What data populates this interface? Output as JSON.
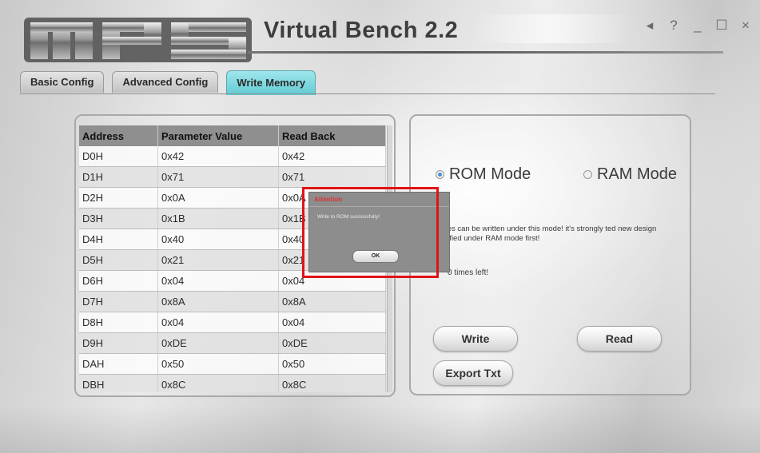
{
  "app": {
    "title": "Virtual Bench 2.2",
    "logo_text": "MPS"
  },
  "window_controls": {
    "sound": "◂",
    "help": "?",
    "minimize": "_",
    "maximize": "☐",
    "close": "×"
  },
  "tabs": [
    {
      "label": "Basic Config",
      "active": false
    },
    {
      "label": "Advanced Config",
      "active": false
    },
    {
      "label": "Write Memory",
      "active": true
    }
  ],
  "table": {
    "headers": [
      "Address",
      "Parameter Value",
      "Read Back"
    ],
    "rows": [
      [
        "D0H",
        "0x42",
        "0x42"
      ],
      [
        "D1H",
        "0x71",
        "0x71"
      ],
      [
        "D2H",
        "0x0A",
        "0x0A"
      ],
      [
        "D3H",
        "0x1B",
        "0x1B"
      ],
      [
        "D4H",
        "0x40",
        "0x40"
      ],
      [
        "D5H",
        "0x21",
        "0x21"
      ],
      [
        "D6H",
        "0x04",
        "0x04"
      ],
      [
        "D7H",
        "0x8A",
        "0x8A"
      ],
      [
        "D8H",
        "0x04",
        "0x04"
      ],
      [
        "D9H",
        "0xDE",
        "0xDE"
      ],
      [
        "DAH",
        "0x50",
        "0x50"
      ],
      [
        "DBH",
        "0x8C",
        "0x8C"
      ]
    ]
  },
  "modes": {
    "rom": {
      "label": "ROM Mode",
      "selected": true
    },
    "ram": {
      "label": "RAM Mode",
      "selected": false
    }
  },
  "warning_text": "times can be written under this mode! it's strongly ted new design verified under RAM mode first!",
  "times_left": "0 times left!",
  "buttons": {
    "write": "Write",
    "read": "Read",
    "export": "Export Txt"
  },
  "dialog": {
    "title": "Attention",
    "message": "Write to ROM successfully!",
    "ok": "OK"
  },
  "colors": {
    "active_tab": "#63cbd3",
    "highlight": "#e01414",
    "table_header": "#8f8f8f"
  }
}
